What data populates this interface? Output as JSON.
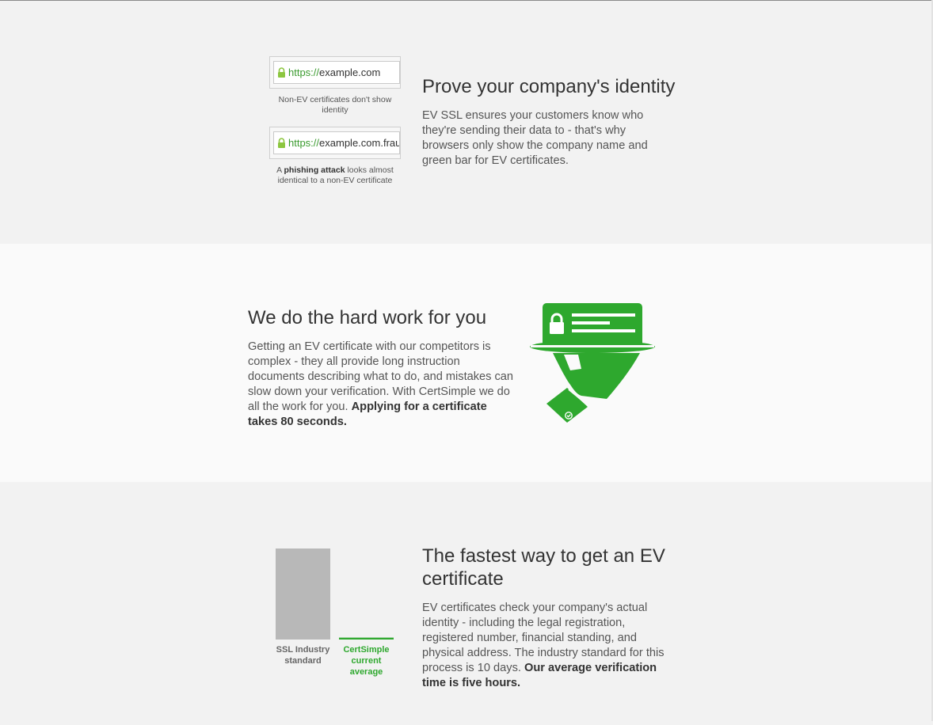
{
  "identity": {
    "url_bar_1": {
      "protocol": "https://",
      "domain": "example.com"
    },
    "caption_1": "Non-EV certificates don't show identity",
    "url_bar_2": {
      "protocol": "https://",
      "domain": "example.com.frau"
    },
    "caption_2": {
      "prefix": "A ",
      "bold": "phishing attack",
      "suffix": " looks almost identical to a non-EV certificate"
    },
    "title": "Prove your company's identity",
    "body": "EV SSL ensures your customers know who they're sending their data to - that's why browsers only show the company name and green bar for EV certificates."
  },
  "hardwork": {
    "title": "We do the hard work for you",
    "body": "Getting an EV certificate with our competitors is complex - they all provide long instruction documents describing what to do, and mistakes can slow down your verification. With CertSimple we do all the work for you.",
    "body_bold": "Applying for a certificate takes 80 seconds.",
    "illustration": "hand-serving-certificate-icon"
  },
  "fastest": {
    "title": "The fastest way to get an EV certificate",
    "body": "EV certificates check your company's actual identity - including the legal registration, registered number, financial standing, and physical address. The industry standard for this process is 10 days.",
    "body_bold": "Our average verification time is five hours."
  },
  "chart_data": {
    "type": "bar",
    "categories": [
      "SSL Industry standard",
      "CertSimple current average"
    ],
    "values": [
      240,
      5
    ],
    "units": "hours",
    "colors": [
      "#b8b8b8",
      "#2ea82e"
    ],
    "ylim": [
      0,
      240
    ],
    "grid": false,
    "title": "",
    "xlabel": "",
    "ylabel": ""
  },
  "colors": {
    "accent": "#2ea82e",
    "brand_green": "#3a9b2e",
    "text": "#444444"
  }
}
